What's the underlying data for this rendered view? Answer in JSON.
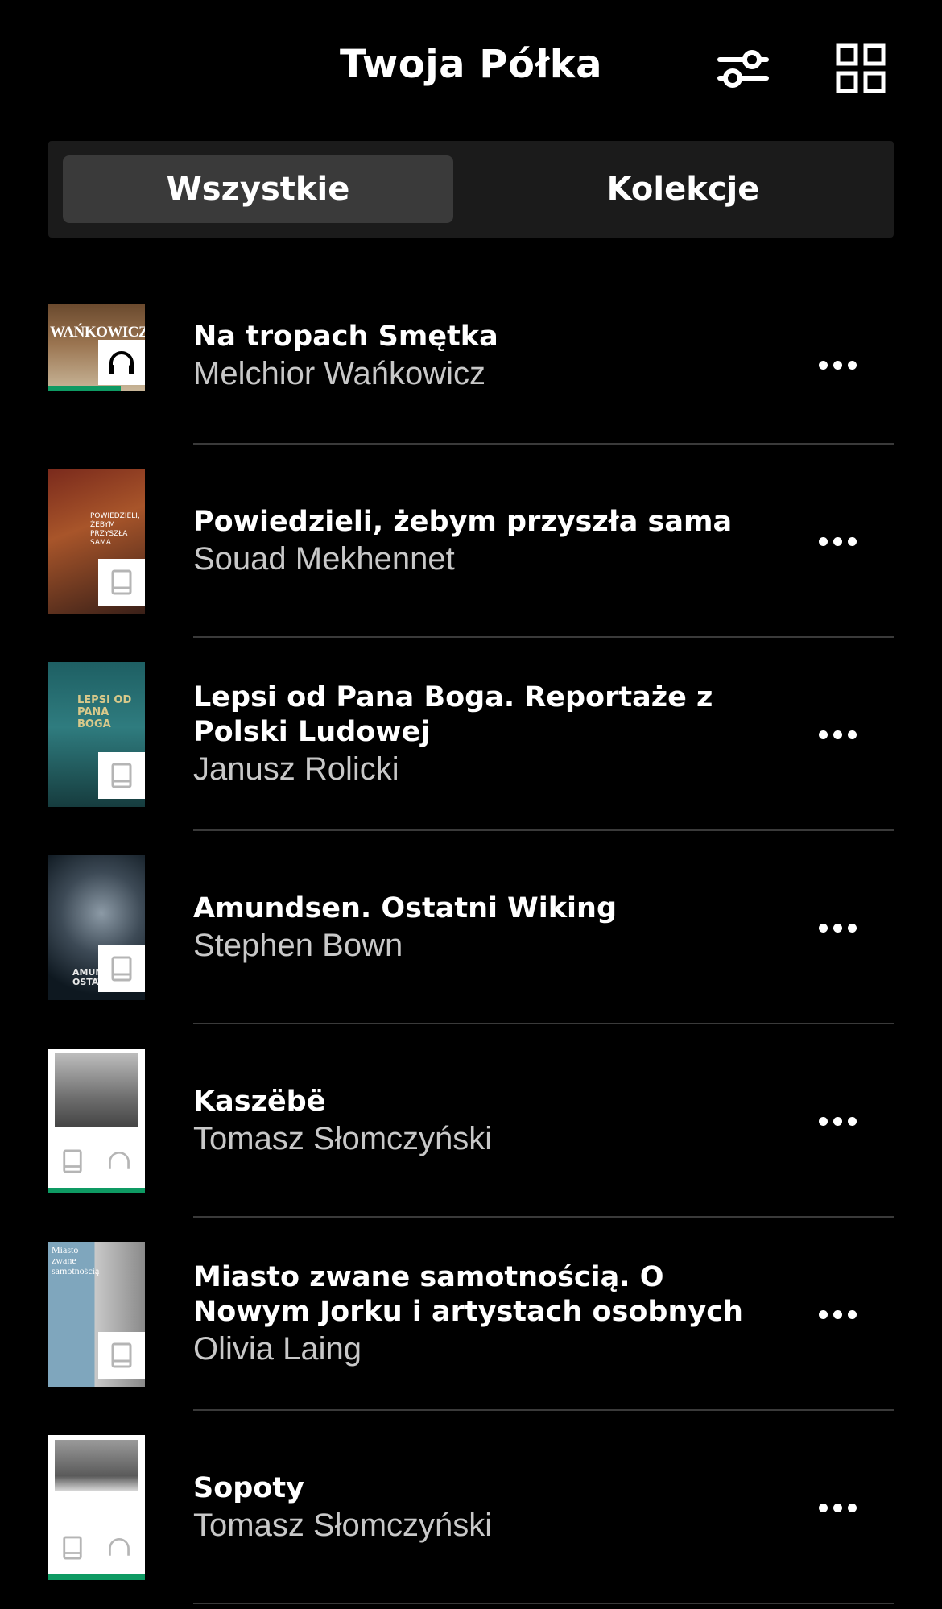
{
  "header": {
    "title": "Twoja Półka",
    "filter_icon": "sliders-icon",
    "grid_icon": "grid-view-icon"
  },
  "tabs": [
    {
      "label": "Wszystkie",
      "active": true
    },
    {
      "label": "Kolekcje",
      "active": false
    }
  ],
  "books": [
    {
      "title": "Na tropach Smętka",
      "author": "Melchior Wańkowicz",
      "format": "audiobook",
      "progress": 0.75,
      "cover_text": "WAŃKOWICZ"
    },
    {
      "title": "Powiedzieli, żebym przyszła sama",
      "author": "Souad Mekhennet",
      "format": "ebook",
      "cover_text": "POWIEDZIELI, ŻEBYM PRZYSZŁA SAMA"
    },
    {
      "title": "Lepsi od Pana Boga. Reportaże z Polski Ludowej",
      "author": "Janusz Rolicki",
      "format": "ebook",
      "cover_text": "LEPSI OD PANA BOGA"
    },
    {
      "title": "Amundsen. Ostatni Wiking",
      "author": "Stephen Bown",
      "format": "ebook",
      "cover_text": "AMUN OSTATN"
    },
    {
      "title": "Kaszëbë",
      "author": "Tomasz Słomczyński",
      "format": "ebook+audiobook",
      "progress": 1.0
    },
    {
      "title": "Miasto zwane samotnością. O Nowym Jorku i artystach osobnych",
      "author": "Olivia Laing",
      "format": "ebook",
      "cover_text": "Miasto zwane samotnością"
    },
    {
      "title": "Sopoty",
      "author": "Tomasz Słomczyński",
      "format": "ebook+audiobook",
      "progress": 1.0
    }
  ],
  "colors": {
    "background": "#000000",
    "progress": "#0e9a63",
    "tab_active": "#3a3a3a",
    "tab_bar": "#1b1b1b"
  }
}
